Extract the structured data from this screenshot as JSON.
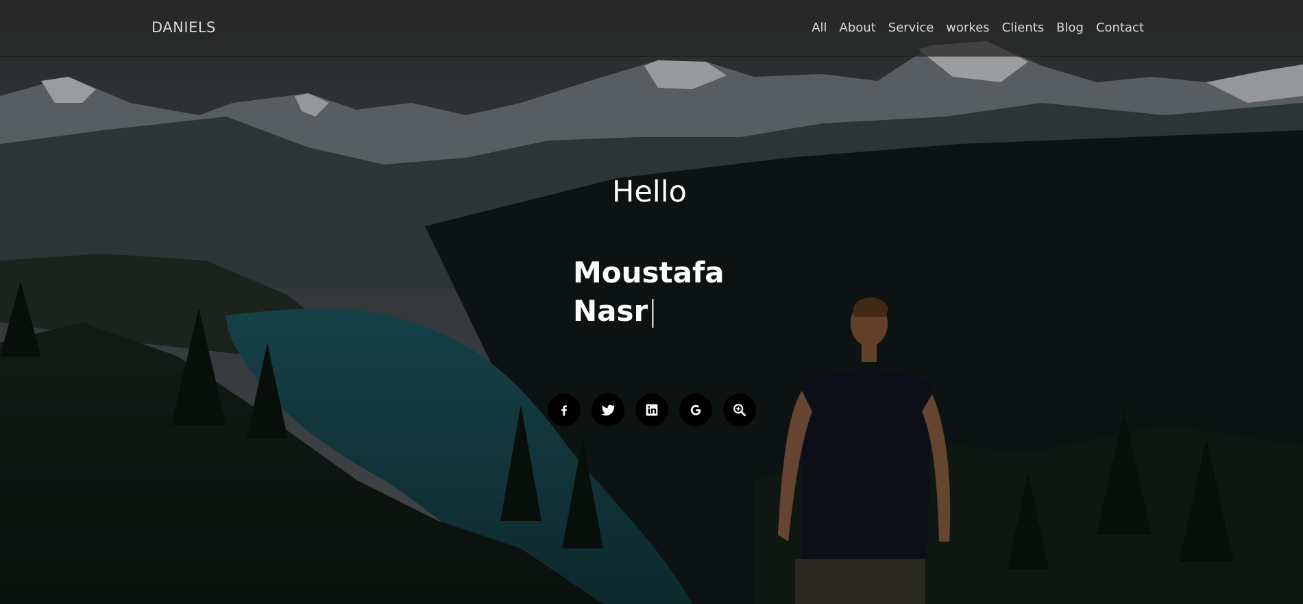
{
  "brand": "DANIELS",
  "nav": {
    "items": [
      {
        "label": "All"
      },
      {
        "label": "About"
      },
      {
        "label": "Service"
      },
      {
        "label": "workes"
      },
      {
        "label": "Clients"
      },
      {
        "label": "Blog"
      },
      {
        "label": "Contact"
      }
    ]
  },
  "hero": {
    "greeting": "Hello",
    "name_line1": "Moustafa",
    "name_line2": "Nasr",
    "caret": "|"
  },
  "socials": [
    {
      "icon": "facebook-icon"
    },
    {
      "icon": "twitter-icon"
    },
    {
      "icon": "linkedin-icon"
    },
    {
      "icon": "google-icon"
    },
    {
      "icon": "zoom-in-icon"
    }
  ],
  "colors": {
    "nav_bg": "#282828",
    "nav_text": "#d8d8d8",
    "hero_text": "#ffffff",
    "social_bg": "#000000"
  }
}
